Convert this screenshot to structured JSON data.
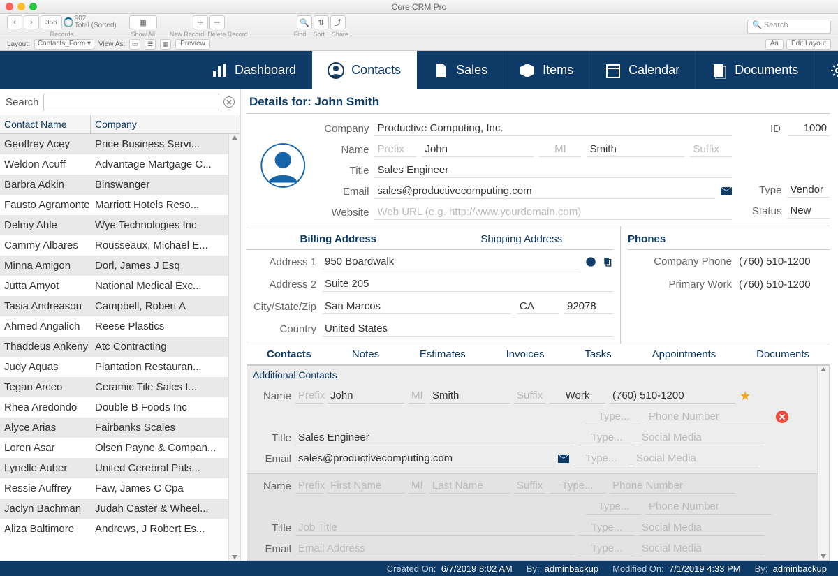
{
  "window_title": "Core CRM Pro",
  "toolbar": {
    "record_current": "366",
    "record_total": "902",
    "record_sort": "Total (Sorted)",
    "records_label": "Records",
    "show_all": "Show All",
    "new_record": "New Record",
    "delete_record": "Delete Record",
    "find": "Find",
    "sort": "Sort",
    "share": "Share",
    "search_placeholder": "Search"
  },
  "subbar": {
    "layout_label": "Layout:",
    "layout_value": "Contacts_Form",
    "view_as": "View As:",
    "preview": "Preview",
    "aa": "Aa",
    "edit_layout": "Edit Layout"
  },
  "nav": {
    "dashboard": "Dashboard",
    "contacts": "Contacts",
    "sales": "Sales",
    "items": "Items",
    "calendar": "Calendar",
    "documents": "Documents",
    "preferences": "Preferences"
  },
  "search_label": "Search",
  "list": {
    "col1": "Contact Name",
    "col2": "Company",
    "rows": [
      {
        "n": "Geoffrey Acey",
        "c": "Price Business Servi..."
      },
      {
        "n": "Weldon Acuff",
        "c": "Advantage Martgage C..."
      },
      {
        "n": "Barbra Adkin",
        "c": "Binswanger"
      },
      {
        "n": "Fausto Agramonte",
        "c": "Marriott Hotels Reso..."
      },
      {
        "n": "Delmy Ahle",
        "c": "Wye Technologies Inc"
      },
      {
        "n": "Cammy Albares",
        "c": "Rousseaux, Michael E..."
      },
      {
        "n": "Minna Amigon",
        "c": "Dorl, James J Esq"
      },
      {
        "n": "Jutta Amyot",
        "c": "National Medical Exc..."
      },
      {
        "n": "Tasia Andreason",
        "c": "Campbell, Robert A"
      },
      {
        "n": "Ahmed Angalich",
        "c": "Reese Plastics"
      },
      {
        "n": "Thaddeus Ankeny",
        "c": "Atc Contracting"
      },
      {
        "n": "Judy Aquas",
        "c": "Plantation Restauran..."
      },
      {
        "n": "Tegan Arceo",
        "c": "Ceramic Tile Sales I..."
      },
      {
        "n": "Rhea Aredondo",
        "c": "Double B Foods Inc"
      },
      {
        "n": "Alyce Arias",
        "c": "Fairbanks Scales"
      },
      {
        "n": "Loren Asar",
        "c": "Olsen Payne & Compan..."
      },
      {
        "n": "Lynelle Auber",
        "c": "United Cerebral Pals..."
      },
      {
        "n": "Ressie Auffrey",
        "c": "Faw, James C Cpa"
      },
      {
        "n": "Jaclyn Bachman",
        "c": "Judah Caster & Wheel..."
      },
      {
        "n": "Aliza Baltimore",
        "c": "Andrews, J Robert Es..."
      }
    ]
  },
  "details": {
    "title_prefix": "Details for: ",
    "title_name": "John Smith",
    "labels": {
      "company": "Company",
      "name": "Name",
      "title": "Title",
      "email": "Email",
      "website": "Website",
      "id": "ID",
      "type": "Type",
      "status": "Status",
      "prefix": "Prefix",
      "mi": "MI",
      "suffix": "Suffix"
    },
    "company": "Productive Computing, Inc.",
    "first": "John",
    "last": "Smith",
    "job_title": "Sales Engineer",
    "email": "sales@productivecomputing.com",
    "website_ph": "Web URL (e.g. http://www.yourdomain.com)",
    "id": "1000",
    "type": "Vendor",
    "status": "New"
  },
  "address": {
    "billing": "Billing Address",
    "shipping": "Shipping Address",
    "phones": "Phones",
    "addr1l": "Address 1",
    "addr1": "950 Boardwalk",
    "addr2l": "Address 2",
    "addr2": "Suite 205",
    "cszl": "City/State/Zip",
    "city": "San Marcos",
    "state": "CA",
    "zip": "92078",
    "countryl": "Country",
    "country": "United States",
    "company_phone_l": "Company Phone",
    "company_phone": "(760) 510-1200",
    "primary_work_l": "Primary Work",
    "primary_work": "(760) 510-1200"
  },
  "dtabs": {
    "contacts": "Contacts",
    "notes": "Notes",
    "estimates": "Estimates",
    "invoices": "Invoices",
    "tasks": "Tasks",
    "appointments": "Appointments",
    "documents": "Documents"
  },
  "additional": {
    "title": "Additional Contacts",
    "labels": {
      "name": "Name",
      "title": "Title",
      "email": "Email",
      "prefix": "Prefix",
      "mi": "MI",
      "suffix": "Suffix",
      "first": "First Name",
      "last": "Last Name",
      "jobtitle": "Job Title",
      "emailaddr": "Email Address",
      "type": "Type...",
      "phone": "Phone Number",
      "social": "Social Media"
    },
    "c1": {
      "first": "John",
      "last": "Smith",
      "title": "Sales Engineer",
      "email": "sales@productivecomputing.com",
      "ptype": "Work",
      "pval": "(760) 510-1200"
    }
  },
  "footer": {
    "created_on_l": "Created On:",
    "created_on": "6/7/2019 8:02 AM",
    "by_l": "By:",
    "created_by": "adminbackup",
    "modified_on_l": "Modified On:",
    "modified_on": "7/1/2019 4:33 PM",
    "modified_by": "adminbackup"
  }
}
